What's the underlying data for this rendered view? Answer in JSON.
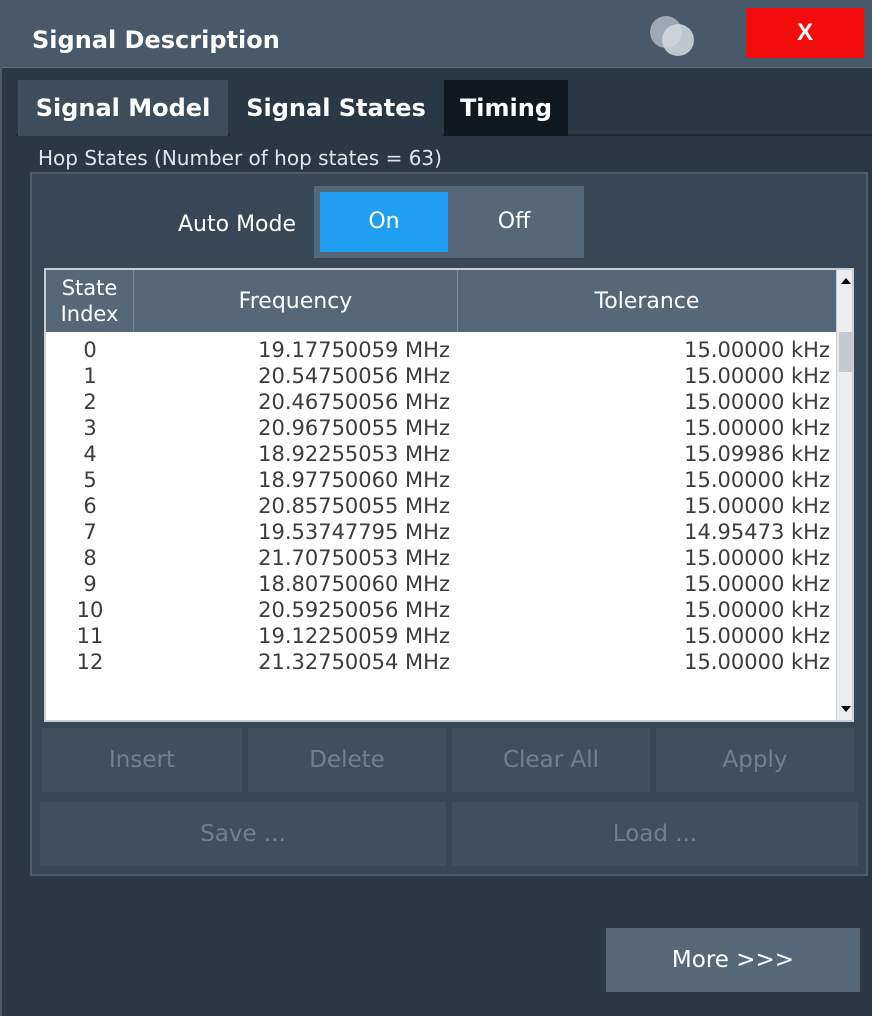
{
  "window": {
    "title": "Signal Description",
    "close_label": "X"
  },
  "tabs": [
    {
      "label": "Signal Model",
      "active": false
    },
    {
      "label": "Signal States",
      "active": true
    },
    {
      "label": "Timing",
      "active": false
    }
  ],
  "hop_states": {
    "group_label": "Hop States (Number of hop states = 63)",
    "auto_mode": {
      "label": "Auto Mode",
      "on_label": "On",
      "off_label": "Off",
      "selected": "On"
    },
    "table": {
      "columns": [
        "State Index",
        "Frequency",
        "Tolerance"
      ],
      "rows": [
        {
          "index": "0",
          "frequency": "19.17750059 MHz",
          "tolerance": "15.00000 kHz"
        },
        {
          "index": "1",
          "frequency": "20.54750056 MHz",
          "tolerance": "15.00000 kHz"
        },
        {
          "index": "2",
          "frequency": "20.46750056 MHz",
          "tolerance": "15.00000 kHz"
        },
        {
          "index": "3",
          "frequency": "20.96750055 MHz",
          "tolerance": "15.00000 kHz"
        },
        {
          "index": "4",
          "frequency": "18.92255053 MHz",
          "tolerance": "15.09986 kHz"
        },
        {
          "index": "5",
          "frequency": "18.97750060 MHz",
          "tolerance": "15.00000 kHz"
        },
        {
          "index": "6",
          "frequency": "20.85750055 MHz",
          "tolerance": "15.00000 kHz"
        },
        {
          "index": "7",
          "frequency": "19.53747795 MHz",
          "tolerance": "14.95473 kHz"
        },
        {
          "index": "8",
          "frequency": "21.70750053 MHz",
          "tolerance": "15.00000 kHz"
        },
        {
          "index": "9",
          "frequency": "18.80750060 MHz",
          "tolerance": "15.00000 kHz"
        },
        {
          "index": "10",
          "frequency": "20.59250056 MHz",
          "tolerance": "15.00000 kHz"
        },
        {
          "index": "11",
          "frequency": "19.12250059 MHz",
          "tolerance": "15.00000 kHz"
        },
        {
          "index": "12",
          "frequency": "21.32750054 MHz",
          "tolerance": "15.00000 kHz"
        }
      ]
    },
    "buttons": {
      "insert": "Insert",
      "delete": "Delete",
      "clear_all": "Clear All",
      "apply": "Apply",
      "save": "Save ...",
      "load": "Load ..."
    }
  },
  "more_button": "More >>>",
  "colors": {
    "accent": "#1e9ff2",
    "close": "#f20c0c",
    "background": "#2a3744"
  },
  "icons": {
    "logo": "overlapping-circles-logo",
    "scroll_up": "triangle-up-icon",
    "scroll_down": "triangle-down-icon"
  }
}
